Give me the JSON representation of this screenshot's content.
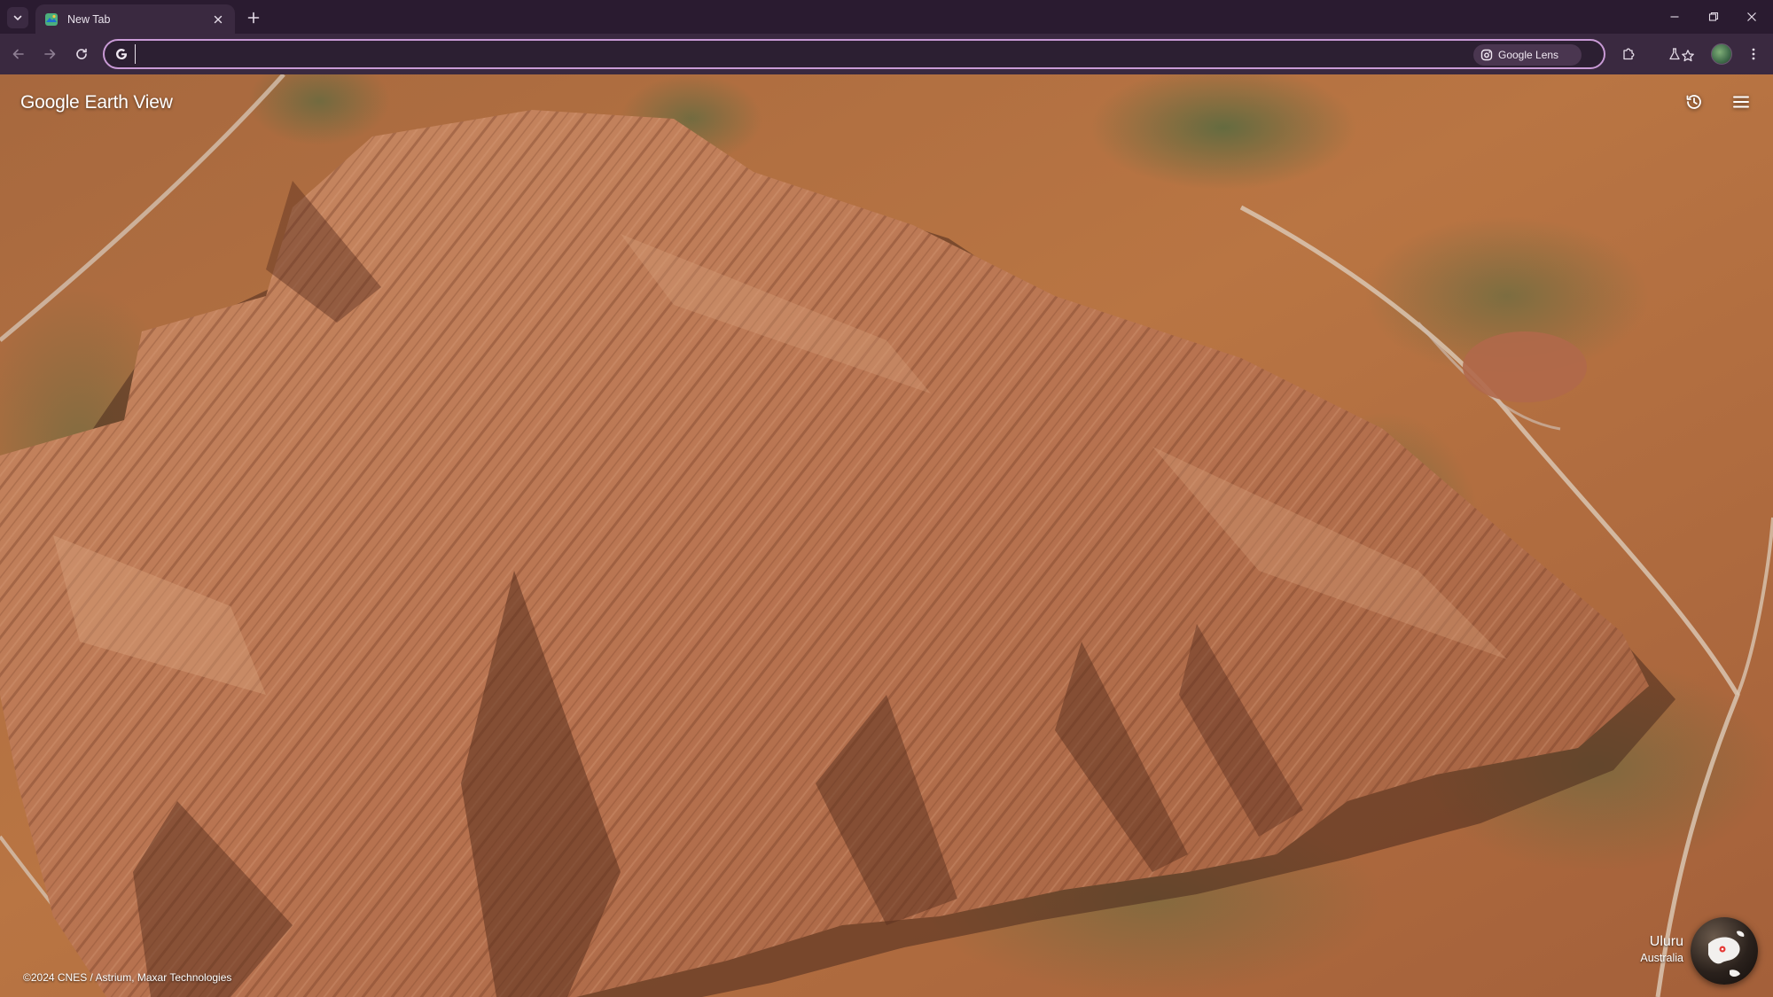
{
  "browser": {
    "tab": {
      "title": "New Tab"
    },
    "omnibox": {
      "value": "",
      "placeholder": ""
    },
    "lens_chip": {
      "label": "Google Lens"
    }
  },
  "earth_view": {
    "brand_google": "Google",
    "brand_product": "Earth View",
    "attribution": "©2024 CNES / Astrium, Maxar Technologies",
    "location": {
      "name": "Uluru",
      "country": "Australia"
    }
  },
  "icons": {
    "tab_search": "chevron-down-icon",
    "favicon": "earth-view-favicon",
    "close": "close-icon",
    "new_tab": "plus-icon",
    "back": "arrow-left-icon",
    "forward": "arrow-right-icon",
    "reload": "reload-icon",
    "google_g": "google-g-icon",
    "lens": "camera-lens-icon",
    "bookmark": "star-icon",
    "extensions": "puzzle-icon",
    "labs": "flask-icon",
    "menu": "kebab-menu-icon",
    "history": "history-icon",
    "hamburger": "hamburger-menu-icon",
    "globe": "globe-icon"
  },
  "colors": {
    "chrome_dark": "#2a1b30",
    "chrome_toolbar": "#3a2940",
    "omnibox_focus": "#c99ad6",
    "rock": "#b7734f",
    "desert": "#b06a3c"
  }
}
